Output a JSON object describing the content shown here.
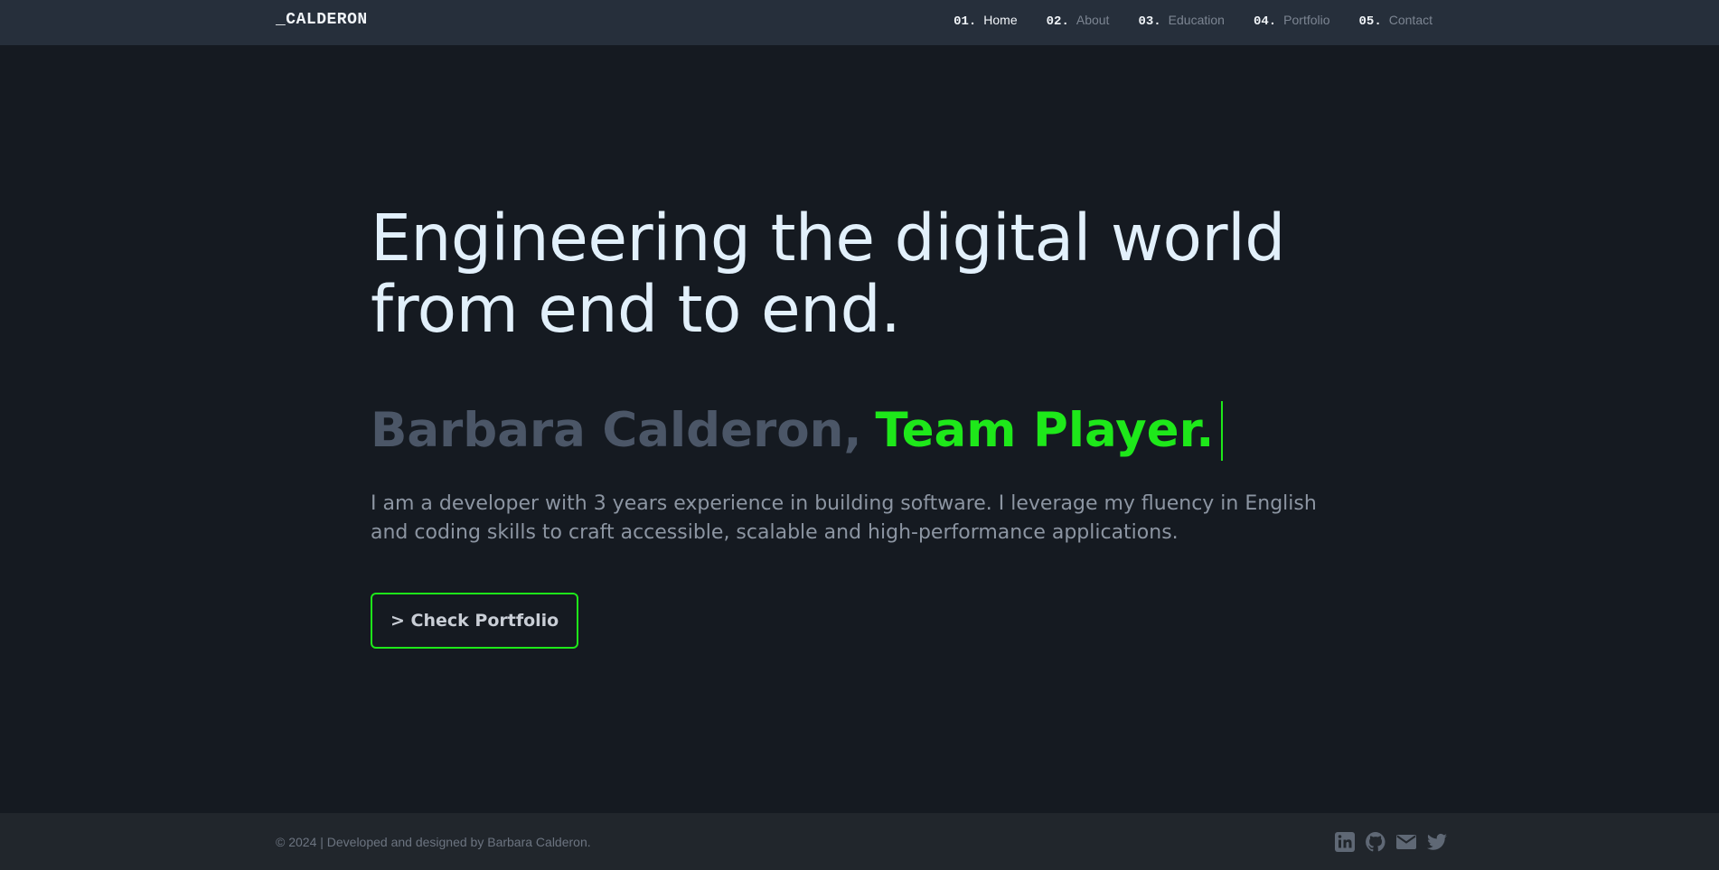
{
  "header": {
    "logo": "_CALDERON",
    "nav": [
      {
        "num": "01.",
        "label": "Home",
        "active": true
      },
      {
        "num": "02.",
        "label": "About",
        "active": false
      },
      {
        "num": "03.",
        "label": "Education",
        "active": false
      },
      {
        "num": "04.",
        "label": "Portfolio",
        "active": false
      },
      {
        "num": "05.",
        "label": "Contact",
        "active": false
      }
    ]
  },
  "hero": {
    "headline_line1": "Engineering the digital world",
    "headline_line2": "from end to end.",
    "name": "Barbara Calderon,",
    "role": "Team Player.",
    "intro": "I am a developer with 3 years experience in building software. I leverage my fluency in English and coding skills to craft accessible, scalable and high-performance applications.",
    "cta_label": "> Check Portfolio"
  },
  "footer": {
    "copyright": "© 2024 | Developed and designed by Barbara Calderon.",
    "socials": [
      "linkedin-icon",
      "github-icon",
      "email-icon",
      "twitter-icon"
    ]
  },
  "colors": {
    "background": "#151a21",
    "header": "#262f3b",
    "footer": "#21262c",
    "accent": "#1ee81a",
    "headline": "#e2f0fb",
    "muted_name": "#4b5667"
  }
}
